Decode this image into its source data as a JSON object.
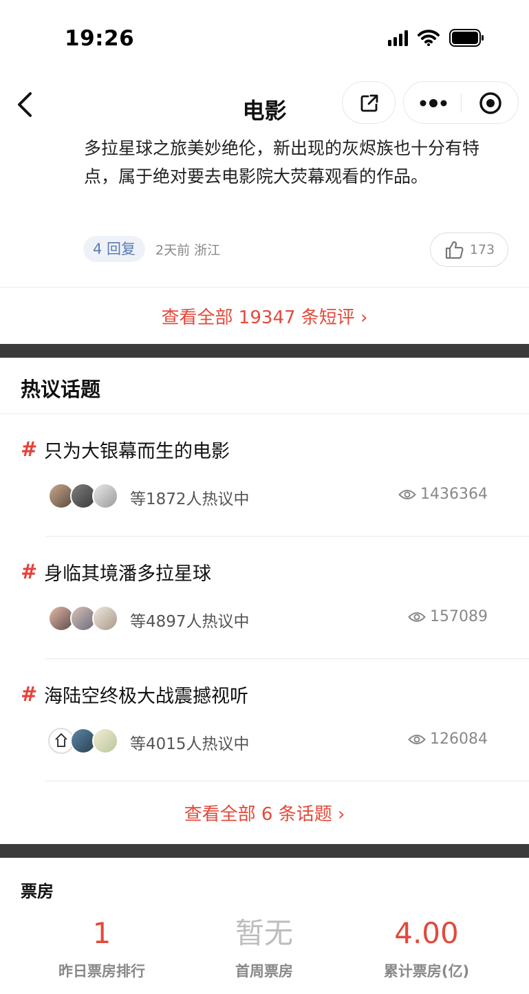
{
  "status_bar": {
    "time": "19:26"
  },
  "nav": {
    "title": "电影"
  },
  "comment": {
    "text": "多拉星球之旅美妙绝伦，新出现的灰烬族也十分有特点，属于绝对要去电影院大荧幕观看的作品。",
    "replies_label": "4 回复",
    "meta": "2天前 浙江",
    "likes": "173"
  },
  "all_reviews_link": "查看全部 19347 条短评 ›",
  "topics_section": {
    "title": "热议话题",
    "hash_symbol": "#",
    "items": [
      {
        "title": "只为大银幕而生的电影",
        "discussing": "等1872人热议中",
        "views": "1436364"
      },
      {
        "title": "身临其境潘多拉星球",
        "discussing": "等4897人热议中",
        "views": "157089"
      },
      {
        "title": "海陆空终极大战震撼视听",
        "discussing": "等4015人热议中",
        "views": "126084"
      }
    ],
    "all_topics_link": "查看全部 6 条话题 ›"
  },
  "boxoffice": {
    "title": "票房",
    "items": [
      {
        "value": "1",
        "label": "昨日票房排行",
        "color": "#e24a3b"
      },
      {
        "value": "暂无",
        "label": "首周票房",
        "color": "#bdbdbd"
      },
      {
        "value": "4.00",
        "label": "累计票房(亿)",
        "color": "#e24a3b"
      }
    ]
  },
  "colors": {
    "accent_red": "#e24a3b",
    "divider_dark": "#3b3b3b"
  }
}
